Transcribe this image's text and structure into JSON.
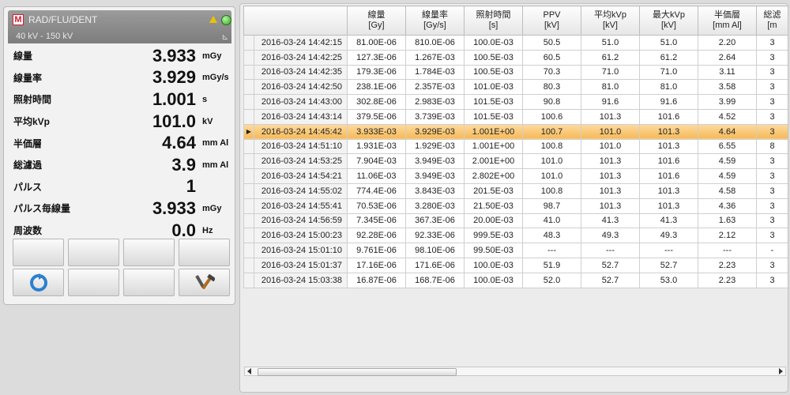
{
  "meter": {
    "device": "RAD/FLU/DENT",
    "range": "40 kV - 150 kV",
    "rows": [
      {
        "label": "線量",
        "value": "3.933",
        "unit": "mGy"
      },
      {
        "label": "線量率",
        "value": "3.929",
        "unit": "mGy/s"
      },
      {
        "label": "照射時間",
        "value": "1.001",
        "unit": "s"
      },
      {
        "label": "平均kVp",
        "value": "101.0",
        "unit": "kV"
      },
      {
        "label": "半価層",
        "value": "4.64",
        "unit": "mm Al"
      },
      {
        "label": "総濾過",
        "value": "3.9",
        "unit": "mm Al"
      },
      {
        "label": "パルス",
        "value": "1",
        "unit": ""
      },
      {
        "label": "パルス毎線量",
        "value": "3.933",
        "unit": "mGy"
      },
      {
        "label": "周波数",
        "value": "0.0",
        "unit": "Hz"
      }
    ],
    "icons": {
      "refresh": "refresh-icon",
      "tools": "tools-icon",
      "status": "status-led-icon",
      "warning": "warning-icon"
    }
  },
  "table": {
    "headers": [
      {
        "name": "線量",
        "unit": "[Gy]"
      },
      {
        "name": "線量率",
        "unit": "[Gy/s]"
      },
      {
        "name": "照射時間",
        "unit": "[s]"
      },
      {
        "name": "PPV",
        "unit": "[kV]"
      },
      {
        "name": "平均kVp",
        "unit": "[kV]"
      },
      {
        "name": "最大kVp",
        "unit": "[kV]"
      },
      {
        "name": "半価層",
        "unit": "[mm Al]"
      },
      {
        "name": "総滤",
        "unit": "[m"
      }
    ],
    "rows": [
      [
        "2016-03-24 14:42:15",
        "81.00E-06",
        "810.0E-06",
        "100.0E-03",
        "50.5",
        "51.0",
        "51.0",
        "2.20",
        "3"
      ],
      [
        "2016-03-24 14:42:25",
        "127.3E-06",
        "1.267E-03",
        "100.5E-03",
        "60.5",
        "61.2",
        "61.2",
        "2.64",
        "3"
      ],
      [
        "2016-03-24 14:42:35",
        "179.3E-06",
        "1.784E-03",
        "100.5E-03",
        "70.3",
        "71.0",
        "71.0",
        "3.11",
        "3"
      ],
      [
        "2016-03-24 14:42:50",
        "238.1E-06",
        "2.357E-03",
        "101.0E-03",
        "80.3",
        "81.0",
        "81.0",
        "3.58",
        "3"
      ],
      [
        "2016-03-24 14:43:00",
        "302.8E-06",
        "2.983E-03",
        "101.5E-03",
        "90.8",
        "91.6",
        "91.6",
        "3.99",
        "3"
      ],
      [
        "2016-03-24 14:43:14",
        "379.5E-06",
        "3.739E-03",
        "101.5E-03",
        "100.6",
        "101.3",
        "101.6",
        "4.52",
        "3"
      ],
      [
        "2016-03-24 14:45:42",
        "3.933E-03",
        "3.929E-03",
        "1.001E+00",
        "100.7",
        "101.0",
        "101.3",
        "4.64",
        "3"
      ],
      [
        "2016-03-24 14:51:10",
        "1.931E-03",
        "1.929E-03",
        "1.001E+00",
        "100.8",
        "101.0",
        "101.3",
        "6.55",
        "8"
      ],
      [
        "2016-03-24 14:53:25",
        "7.904E-03",
        "3.949E-03",
        "2.001E+00",
        "101.0",
        "101.3",
        "101.6",
        "4.59",
        "3"
      ],
      [
        "2016-03-24 14:54:21",
        "11.06E-03",
        "3.949E-03",
        "2.802E+00",
        "101.0",
        "101.3",
        "101.6",
        "4.59",
        "3"
      ],
      [
        "2016-03-24 14:55:02",
        "774.4E-06",
        "3.843E-03",
        "201.5E-03",
        "100.8",
        "101.3",
        "101.3",
        "4.58",
        "3"
      ],
      [
        "2016-03-24 14:55:41",
        "70.53E-06",
        "3.280E-03",
        "21.50E-03",
        "98.7",
        "101.3",
        "101.3",
        "4.36",
        "3"
      ],
      [
        "2016-03-24 14:56:59",
        "7.345E-06",
        "367.3E-06",
        "20.00E-03",
        "41.0",
        "41.3",
        "41.3",
        "1.63",
        "3"
      ],
      [
        "2016-03-24 15:00:23",
        "92.28E-06",
        "92.33E-06",
        "999.5E-03",
        "48.3",
        "49.3",
        "49.3",
        "2.12",
        "3"
      ],
      [
        "2016-03-24 15:01:10",
        "9.761E-06",
        "98.10E-06",
        "99.50E-03",
        "---",
        "---",
        "---",
        "---",
        "-"
      ],
      [
        "2016-03-24 15:01:37",
        "17.16E-06",
        "171.6E-06",
        "100.0E-03",
        "51.9",
        "52.7",
        "52.7",
        "2.23",
        "3"
      ],
      [
        "2016-03-24 15:03:38",
        "16.87E-06",
        "168.7E-06",
        "100.0E-03",
        "52.0",
        "52.7",
        "53.0",
        "2.23",
        "3"
      ]
    ],
    "selected_row": 6
  },
  "colors": {
    "selected_row": "#f6b957",
    "accent_blue": "#2b7fd0"
  }
}
